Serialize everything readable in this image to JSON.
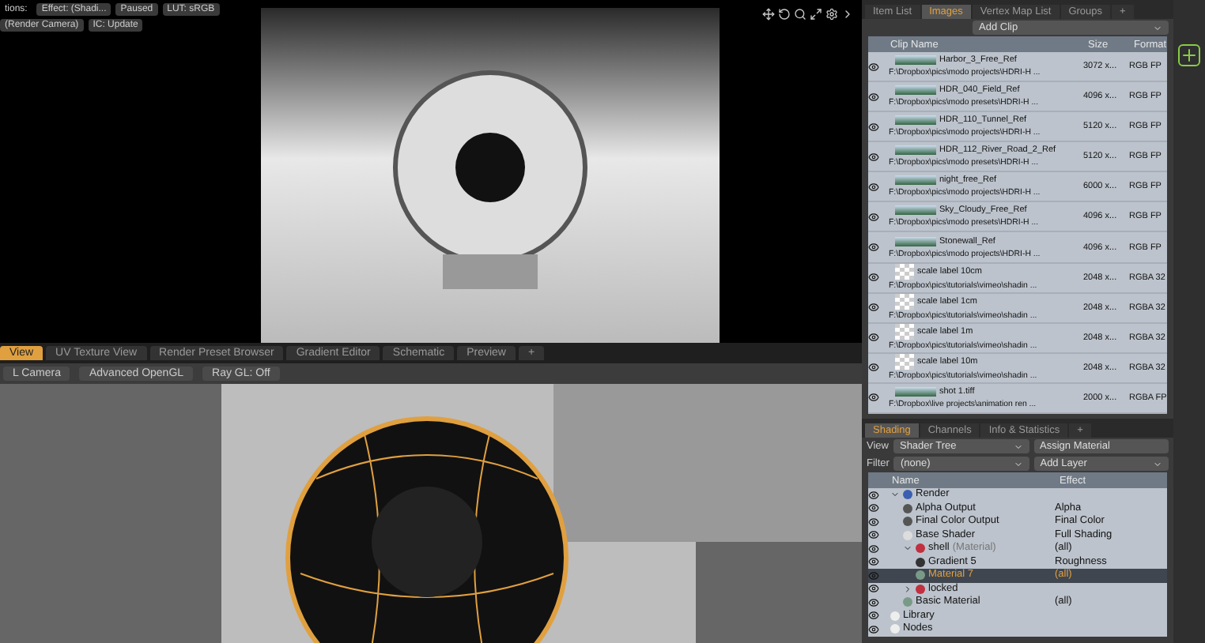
{
  "preview": {
    "toolbar": [
      [
        {
          "label": "tions:",
          "kind": "label"
        },
        {
          "label": "Effect: (Shadi...",
          "kind": "button"
        },
        {
          "label": "Paused",
          "kind": "button"
        },
        {
          "label": "LUT: sRGB",
          "kind": "button"
        }
      ],
      [
        {
          "label": "(Render Camera)",
          "kind": "button"
        },
        {
          "label": "IC: Update",
          "kind": "button"
        }
      ]
    ]
  },
  "viewport_tabs": [
    {
      "label": "View",
      "selected": true
    },
    {
      "label": "UV Texture View",
      "selected": false
    },
    {
      "label": "Render Preset Browser",
      "selected": false
    },
    {
      "label": "Gradient Editor",
      "selected": false
    },
    {
      "label": "Schematic",
      "selected": false
    },
    {
      "label": "Preview",
      "selected": false
    },
    {
      "label": "+",
      "selected": false
    }
  ],
  "viewport_toolbar": [
    "L Camera",
    "Advanced OpenGL",
    "Ray GL: Off"
  ],
  "images_panel": {
    "tabs": [
      {
        "label": "Item List",
        "selected": false
      },
      {
        "label": "Images",
        "selected": true
      },
      {
        "label": "Vertex Map List",
        "selected": false
      },
      {
        "label": "Groups",
        "selected": false
      },
      {
        "label": "+",
        "selected": false
      }
    ],
    "add_clip": "Add Clip",
    "columns": [
      "Clip Name",
      "Size",
      "Format"
    ],
    "clips": [
      {
        "name": "Harbor_3_Free_Ref",
        "path": "F:\\Dropbox\\pics\\modo projects\\HDRI-H ...",
        "size": "3072 x...",
        "format": "RGB FP",
        "kind": "photo"
      },
      {
        "name": "HDR_040_Field_Ref",
        "path": "F:\\Dropbox\\pics\\modo presets\\HDRI-H ...",
        "size": "4096 x...",
        "format": "RGB FP",
        "kind": "photo"
      },
      {
        "name": "HDR_110_Tunnel_Ref",
        "path": "F:\\Dropbox\\pics\\modo projects\\HDRI-H ...",
        "size": "5120 x...",
        "format": "RGB FP",
        "kind": "photo"
      },
      {
        "name": "HDR_112_River_Road_2_Ref",
        "path": "F:\\Dropbox\\pics\\modo presets\\HDRI-H ...",
        "size": "5120 x...",
        "format": "RGB FP",
        "kind": "photo"
      },
      {
        "name": "night_free_Ref",
        "path": "F:\\Dropbox\\pics\\modo projects\\HDRI-H ...",
        "size": "6000 x...",
        "format": "RGB FP",
        "kind": "photo"
      },
      {
        "name": "Sky_Cloudy_Free_Ref",
        "path": "F:\\Dropbox\\pics\\modo presets\\HDRI-H ...",
        "size": "4096 x...",
        "format": "RGB FP",
        "kind": "photo"
      },
      {
        "name": "Stonewall_Ref",
        "path": "F:\\Dropbox\\pics\\modo projects\\HDRI-H ...",
        "size": "4096 x...",
        "format": "RGB FP",
        "kind": "photo"
      },
      {
        "name": "scale label 10cm",
        "path": "F:\\Dropbox\\pics\\tutorials\\vimeo\\shadin ...",
        "size": "2048 x...",
        "format": "RGBA 32",
        "kind": "checker"
      },
      {
        "name": "scale label 1cm",
        "path": "F:\\Dropbox\\pics\\tutorials\\vimeo\\shadin ...",
        "size": "2048 x...",
        "format": "RGBA 32",
        "kind": "checker"
      },
      {
        "name": "scale label 1m",
        "path": "F:\\Dropbox\\pics\\tutorials\\vimeo\\shadin ...",
        "size": "2048 x...",
        "format": "RGBA 32",
        "kind": "checker"
      },
      {
        "name": "scale label 10m",
        "path": "F:\\Dropbox\\pics\\tutorials\\vimeo\\shadin ...",
        "size": "2048 x...",
        "format": "RGBA 32",
        "kind": "checker"
      },
      {
        "name": "shot 1.tiff",
        "path": "F:\\Dropbox\\live projects\\animation ren ...",
        "size": "2000 x...",
        "format": "RGBA FP",
        "kind": "photo"
      }
    ]
  },
  "shading_panel": {
    "tabs": [
      {
        "label": "Shading",
        "selected": true
      },
      {
        "label": "Channels",
        "selected": false
      },
      {
        "label": "Info & Statistics",
        "selected": false
      },
      {
        "label": "+",
        "selected": false
      }
    ],
    "view_label": "View",
    "view_value": "Shader Tree",
    "assign": "Assign Material",
    "filter_label": "Filter",
    "filter_value": "(none)",
    "add_layer": "Add Layer",
    "columns": [
      "Name",
      "Effect"
    ],
    "tree": [
      {
        "name": "Render",
        "kind": "render",
        "expanded": true,
        "selected": false,
        "children": [
          {
            "name": "Alpha Output",
            "effect": "Alpha",
            "kind": "output",
            "selected": false
          },
          {
            "name": "Final Color Output",
            "effect": "Final Color",
            "kind": "output",
            "selected": false
          },
          {
            "name": "Base Shader",
            "effect": "Full Shading",
            "kind": "shader",
            "selected": false
          },
          {
            "name": "shell",
            "note": "(Material)",
            "effect": "(all)",
            "kind": "group",
            "expanded": true,
            "selected": false,
            "children": [
              {
                "name": "Gradient 5",
                "effect": "Roughness",
                "kind": "gradient",
                "selected": false
              },
              {
                "name": "Material 7",
                "effect": "(all)",
                "kind": "material",
                "selected": true
              }
            ]
          },
          {
            "name": "locked",
            "kind": "group",
            "expanded": false,
            "selected": false
          },
          {
            "name": "Basic Material",
            "effect": "(all)",
            "kind": "material",
            "selected": false
          }
        ]
      },
      {
        "name": "Library",
        "kind": "folder",
        "selected": false
      },
      {
        "name": "Nodes",
        "kind": "folder",
        "selected": false
      }
    ]
  }
}
